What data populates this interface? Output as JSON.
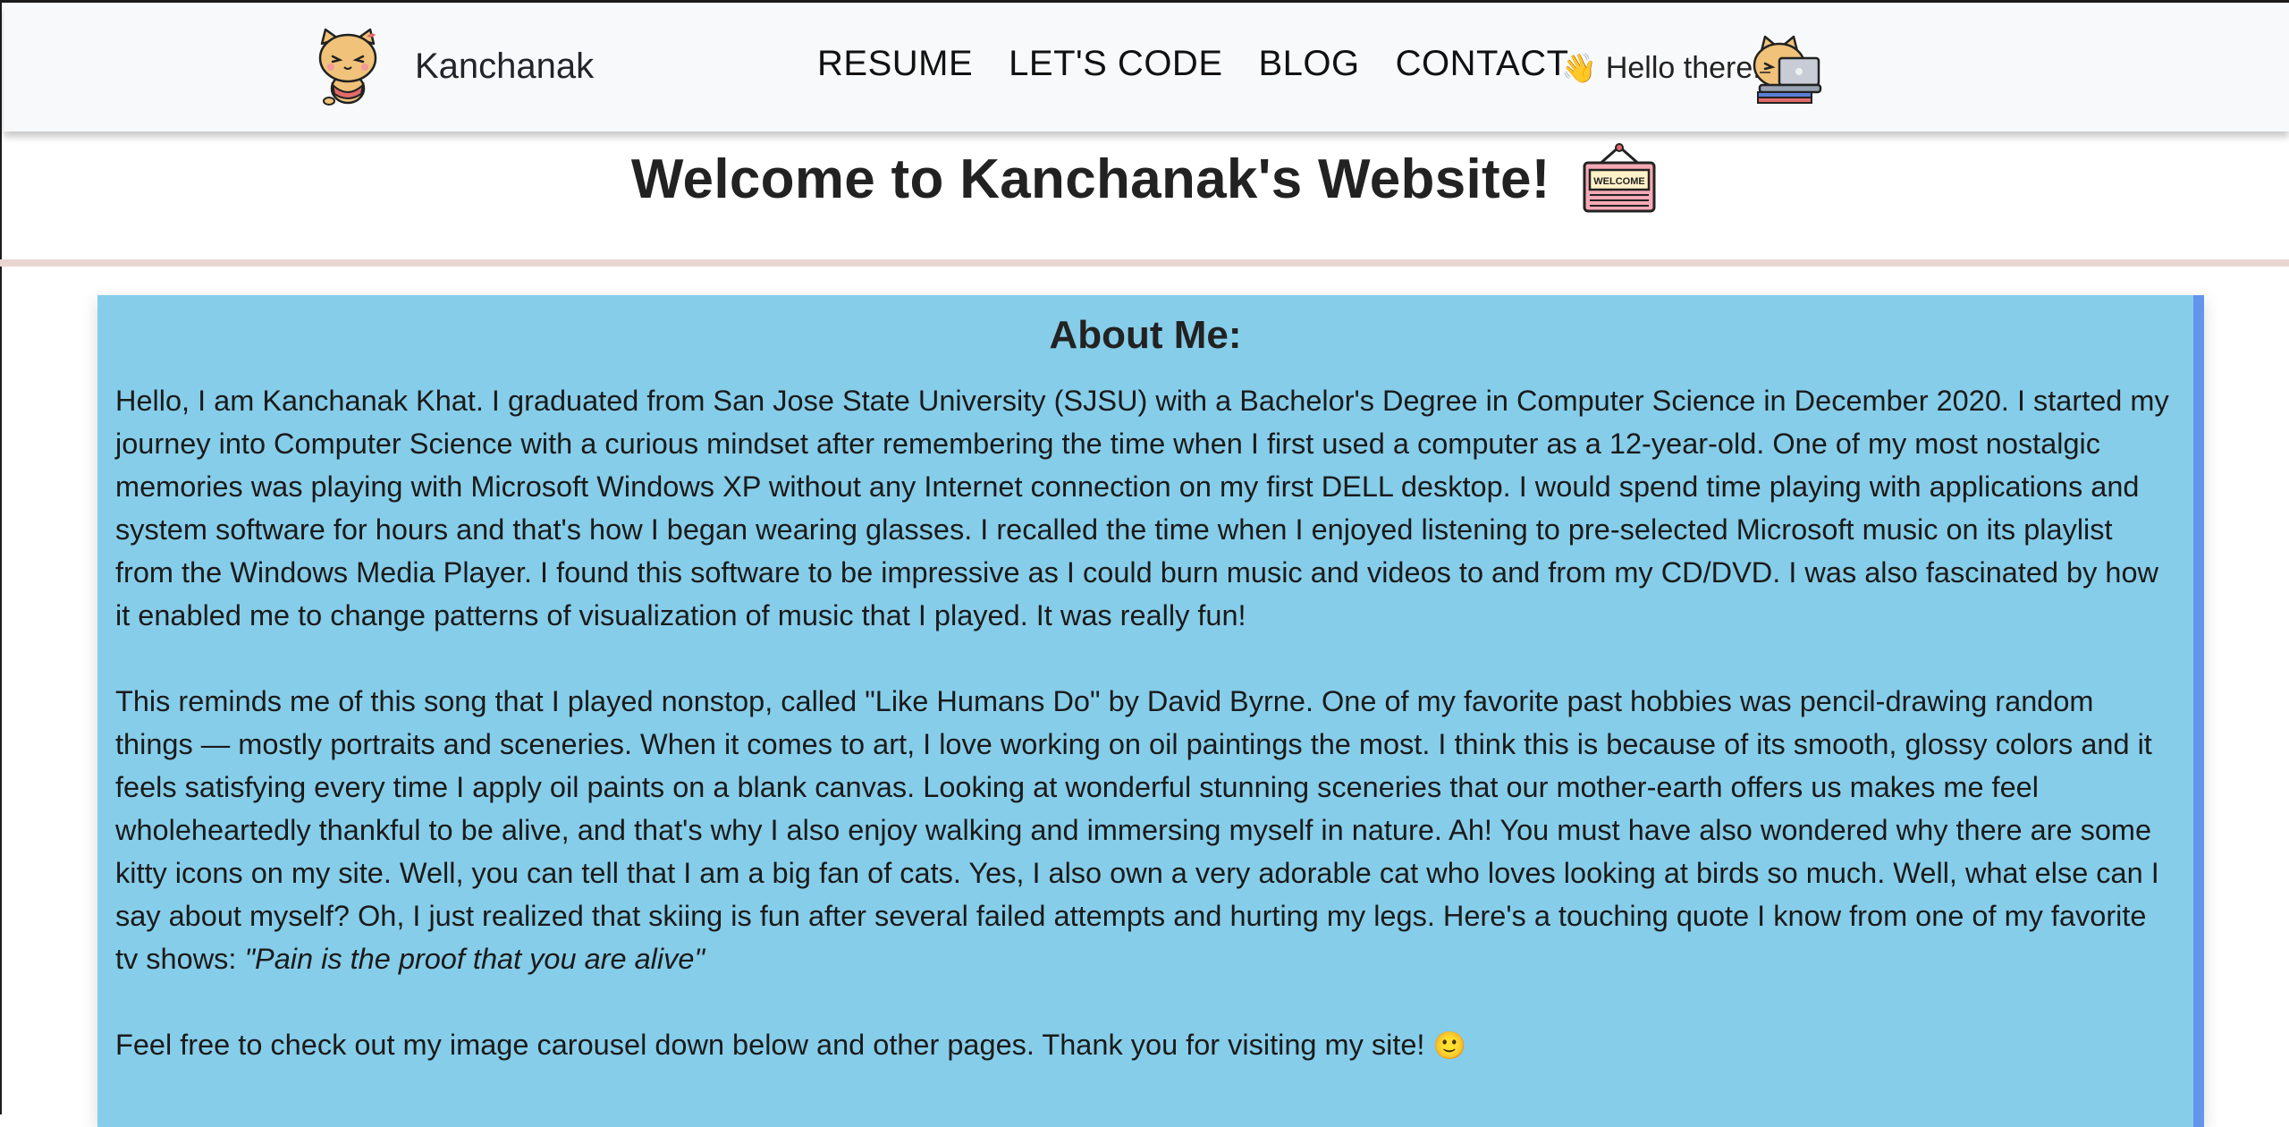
{
  "nav": {
    "brand": "Kanchanak",
    "links": [
      "RESUME",
      "LET'S CODE",
      "BLOG",
      "CONTACT"
    ],
    "greeting_emoji": "👋",
    "greeting": "Hello there!"
  },
  "header": {
    "title": "Welcome to Kanchanak's Website!",
    "sign_text": "WELCOME"
  },
  "about": {
    "title": "About Me:",
    "paragraph1": "Hello, I am Kanchanak Khat. I graduated from San Jose State University (SJSU) with a Bachelor's Degree in Computer Science in December 2020. I started my journey into Computer Science with a curious mindset after remembering the time when I first used a computer as a 12-year-old. One of my most nostalgic memories was playing with Microsoft Windows XP without any Internet connection on my first DELL desktop. I would spend time playing with applications and system software for hours and that's how I began wearing glasses. I recalled the time when I enjoyed listening to pre-selected Microsoft music on its playlist from the Windows Media Player. I found this software to be impressive as I could burn music and videos to and from my CD/DVD. I was also fascinated by how it enabled me to change patterns of visualization of music that I played. It was really fun!",
    "paragraph2": "This reminds me of this song that I played nonstop, called \"Like Humans Do\" by David Byrne. One of my favorite past hobbies was pencil-drawing random things — mostly portraits and sceneries. When it comes to art, I love working on oil paintings the most. I think this is because of its smooth, glossy colors and it feels satisfying every time I apply oil paints on a blank canvas. Looking at wonderful stunning sceneries that our mother-earth offers us makes me feel wholeheartedly thankful to be alive, and that's why I also enjoy walking and immersing myself in nature. Ah! You must have also wondered why there are some kitty icons on my site. Well, you can tell that I am a big fan of cats. Yes, I also own a very adorable cat who loves looking at birds so much. Well, what else can I say about myself? Oh, I just realized that skiing is fun after several failed attempts and hurting my legs. Here's a touching quote I know from one of my favorite tv shows: ",
    "quote": "\"Pain is the proof that you are alive\"",
    "paragraph3": "Feel free to check out my image carousel down below and other pages. Thank you for visiting my site! ",
    "smile": "🙂"
  },
  "colors": {
    "navbar_bg": "#f8f9fa",
    "about_bg": "#86cde9",
    "about_border": "#6495ed",
    "divider": "#ead5d2"
  }
}
